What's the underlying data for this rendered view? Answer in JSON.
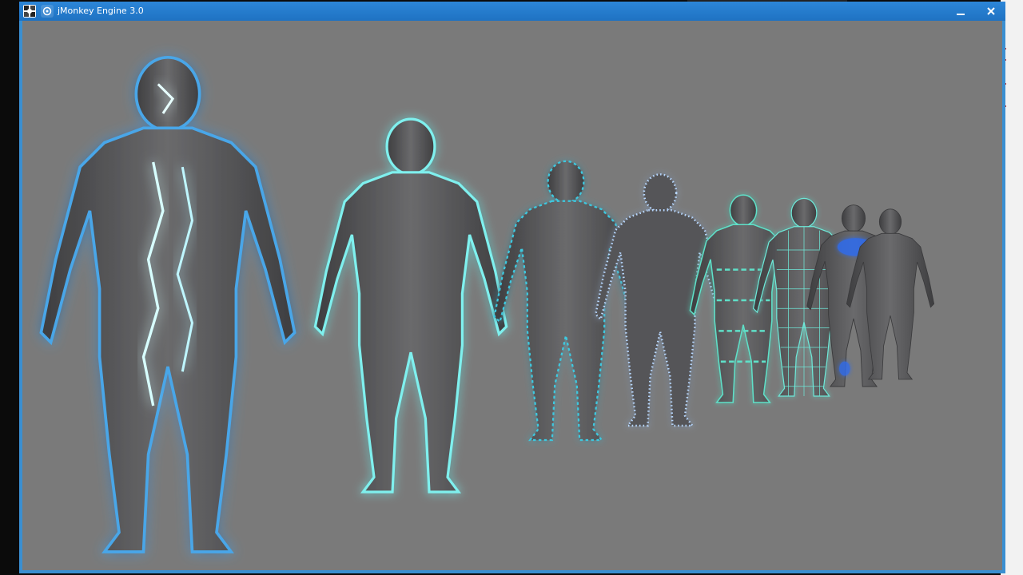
{
  "window": {
    "title": "jMonkey Engine 3.0",
    "icons": {
      "app": "jmonkey-logo-icon",
      "menu": "window-menu-icon",
      "minimize": "minimize-icon",
      "close": "close-icon"
    }
  },
  "scene": {
    "background_color": "#7a7a7a",
    "figure_color": "#5a5a5c",
    "glow_colors": [
      "#5fd8e8",
      "#4aa6e8",
      "#2f6cf0"
    ]
  }
}
